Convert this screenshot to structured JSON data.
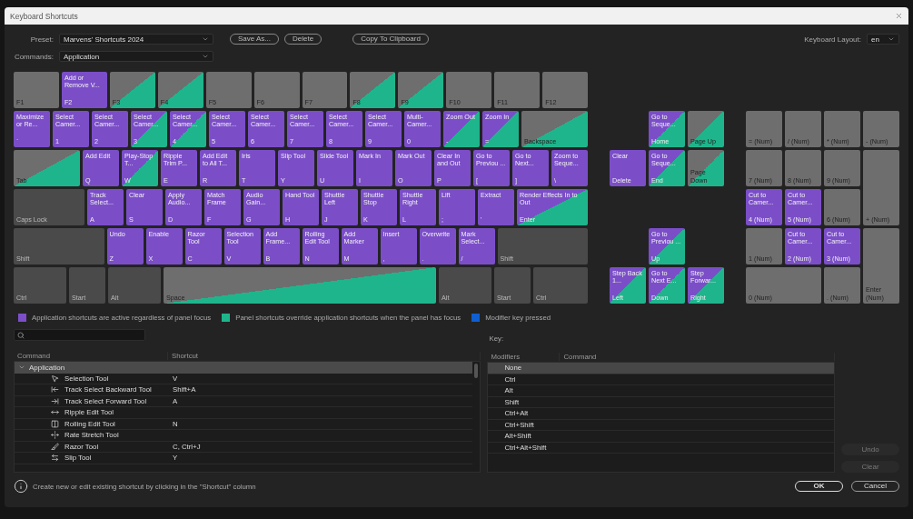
{
  "window": {
    "title": "Keyboard Shortcuts"
  },
  "preset": {
    "label": "Preset:",
    "value": "Marvens' Shortcuts 2024"
  },
  "actions": [
    "Save As...",
    "Delete",
    "Copy To Clipboard"
  ],
  "keyboard_layout": {
    "label": "Keyboard Layout:",
    "value": "en"
  },
  "commands": {
    "label": "Commands:",
    "value": "Application"
  },
  "keyboard": {
    "main_rows": [
      [
        {
          "label": "F1",
          "kind": "empty"
        },
        {
          "label": "F2",
          "kind": "app",
          "command": "Add or Remove V..."
        },
        {
          "label": "F3",
          "kind": "panel"
        },
        {
          "label": "F4",
          "kind": "panel"
        },
        {
          "label": "F5",
          "kind": "empty"
        },
        {
          "label": "F6",
          "kind": "empty"
        },
        {
          "label": "F7",
          "kind": "empty"
        },
        {
          "label": "F8",
          "kind": "panel"
        },
        {
          "label": "F9",
          "kind": "panel"
        },
        {
          "label": "F10",
          "kind": "empty"
        },
        {
          "label": "F11",
          "kind": "empty"
        },
        {
          "label": "F12",
          "kind": "empty"
        }
      ],
      [
        {
          "label": "`",
          "kind": "app",
          "command": "Maximize or Re..."
        },
        {
          "label": "1",
          "kind": "app",
          "command": "Select Camer..."
        },
        {
          "label": "2",
          "kind": "app",
          "command": "Select Camer..."
        },
        {
          "label": "3",
          "kind": "both",
          "command": "Select Camer..."
        },
        {
          "label": "4",
          "kind": "both",
          "command": "Select Camer..."
        },
        {
          "label": "5",
          "kind": "app",
          "command": "Select Camer..."
        },
        {
          "label": "6",
          "kind": "app",
          "command": "Select Camer..."
        },
        {
          "label": "7",
          "kind": "app",
          "command": "Select Camer..."
        },
        {
          "label": "8",
          "kind": "app",
          "command": "Select Camer..."
        },
        {
          "label": "9",
          "kind": "app",
          "command": "Select Camer..."
        },
        {
          "label": "0",
          "kind": "app",
          "command": "Multi-Camer..."
        },
        {
          "label": "-",
          "kind": "both",
          "command": "Zoom Out"
        },
        {
          "label": "=",
          "kind": "both",
          "command": "Zoom In"
        },
        {
          "label": "Backspace",
          "kind": "panel"
        }
      ],
      [
        {
          "label": "Tab",
          "kind": "panel"
        },
        {
          "label": "Q",
          "kind": "app",
          "command": "Add Edit"
        },
        {
          "label": "W",
          "kind": "both",
          "command": "Play-Stop T..."
        },
        {
          "label": "E",
          "kind": "app",
          "command": "Ripple Trim P..."
        },
        {
          "label": "R",
          "kind": "app",
          "command": "Add Edit to All T..."
        },
        {
          "label": "T",
          "kind": "app",
          "command": "Iris"
        },
        {
          "label": "Y",
          "kind": "app",
          "command": "Slip Tool"
        },
        {
          "label": "U",
          "kind": "app",
          "command": "Slide Tool"
        },
        {
          "label": "I",
          "kind": "app",
          "command": "Mark In"
        },
        {
          "label": "O",
          "kind": "app",
          "command": "Mark Out"
        },
        {
          "label": "P",
          "kind": "app",
          "command": "Clear In and Out"
        },
        {
          "label": "[",
          "kind": "app",
          "command": "Go to Previou ..."
        },
        {
          "label": "]",
          "kind": "app",
          "command": "Go to Next..."
        },
        {
          "label": "\\",
          "kind": "app",
          "command": "Zoom to Seque..."
        }
      ],
      [
        {
          "label": "Caps Lock",
          "kind": "modifier"
        },
        {
          "label": "A",
          "kind": "app",
          "command": "Track Select..."
        },
        {
          "label": "S",
          "kind": "app",
          "command": "Clear"
        },
        {
          "label": "D",
          "kind": "app",
          "command": "Apply Audio..."
        },
        {
          "label": "F",
          "kind": "app",
          "command": "Match Frame"
        },
        {
          "label": "G",
          "kind": "app",
          "command": "Audio Gain..."
        },
        {
          "label": "H",
          "kind": "app",
          "command": "Hand Tool"
        },
        {
          "label": "J",
          "kind": "app",
          "command": "Shuttle Left"
        },
        {
          "label": "K",
          "kind": "app",
          "command": "Shuttle Stop"
        },
        {
          "label": "L",
          "kind": "app",
          "command": "Shuttle Right"
        },
        {
          "label": ";",
          "kind": "app",
          "command": "Lift"
        },
        {
          "label": "'",
          "kind": "app",
          "command": "Extract"
        },
        {
          "label": "Enter",
          "kind": "both",
          "command": "Render Effects In to Out"
        }
      ],
      [
        {
          "label": "Shift",
          "kind": "modifier"
        },
        {
          "label": "Z",
          "kind": "app",
          "command": "Undo"
        },
        {
          "label": "X",
          "kind": "app",
          "command": "Enable"
        },
        {
          "label": "C",
          "kind": "app",
          "command": "Razor Tool"
        },
        {
          "label": "V",
          "kind": "app",
          "command": "Selection Tool"
        },
        {
          "label": "B",
          "kind": "app",
          "command": "Add Frame..."
        },
        {
          "label": "N",
          "kind": "app",
          "command": "Rolling Edit Tool"
        },
        {
          "label": "M",
          "kind": "app",
          "command": "Add Marker"
        },
        {
          "label": ",",
          "kind": "app",
          "command": "Insert"
        },
        {
          "label": ".",
          "kind": "app",
          "command": "Overwrite"
        },
        {
          "label": "/",
          "kind": "app",
          "command": "Mark Select..."
        },
        {
          "label": "Shift",
          "kind": "modifier"
        }
      ],
      [
        {
          "label": "Ctrl",
          "kind": "modifier"
        },
        {
          "label": "Start",
          "kind": "modifier"
        },
        {
          "label": "Alt",
          "kind": "modifier"
        },
        {
          "label": "Space",
          "kind": "panel"
        },
        {
          "label": "Alt",
          "kind": "modifier"
        },
        {
          "label": "Start",
          "kind": "modifier"
        },
        {
          "label": "Ctrl",
          "kind": "modifier"
        }
      ]
    ],
    "nav": [
      {
        "label": "Home",
        "kind": "both",
        "command": "Go to Seque..."
      },
      {
        "label": "Page Up",
        "kind": "panel"
      },
      {
        "label": "Delete",
        "kind": "app",
        "command": "Clear"
      },
      {
        "label": "End",
        "kind": "both",
        "command": "Go to Seque..."
      },
      {
        "label": "Page Down",
        "kind": "panel"
      },
      {
        "label": "Up",
        "kind": "both",
        "command": "Go to Previou ..."
      },
      {
        "label": "Left",
        "kind": "both",
        "command": "Step Back 1..."
      },
      {
        "label": "Down",
        "kind": "both",
        "command": "Go to Next E..."
      },
      {
        "label": "Right",
        "kind": "both",
        "command": "Step Forwar..."
      }
    ],
    "numpad": [
      {
        "label": "= (Num)",
        "kind": "empty"
      },
      {
        "label": "/ (Num)",
        "kind": "empty"
      },
      {
        "label": "* (Num)",
        "kind": "empty"
      },
      {
        "label": "- (Num)",
        "kind": "empty"
      },
      {
        "label": "7 (Num)",
        "kind": "empty"
      },
      {
        "label": "8 (Num)",
        "kind": "empty"
      },
      {
        "label": "9 (Num)",
        "kind": "empty"
      },
      {
        "label": "4 (Num)",
        "kind": "app",
        "command": "Cut to Camer..."
      },
      {
        "label": "5 (Num)",
        "kind": "app",
        "command": "Cut to Camer..."
      },
      {
        "label": "6 (Num)",
        "kind": "empty"
      },
      {
        "label": "+ (Num)",
        "kind": "empty"
      },
      {
        "label": "1 (Num)",
        "kind": "empty"
      },
      {
        "label": "2 (Num)",
        "kind": "app",
        "command": "Cut to Camer..."
      },
      {
        "label": "3 (Num)",
        "kind": "app",
        "command": "Cut to Camer..."
      },
      {
        "label": "0 (Num)",
        "kind": "empty"
      },
      {
        "label": ". (Num)",
        "kind": "empty"
      },
      {
        "label": "Enter (Num)",
        "kind": "empty"
      }
    ]
  },
  "legend": [
    {
      "text": "Application shortcuts are active regardless of panel focus",
      "color": "#7c4fc8"
    },
    {
      "text": "Panel shortcuts override application shortcuts when the panel has focus",
      "color": "#1fb58c"
    },
    {
      "text": "Modifier key pressed",
      "color": "#0f5fd0"
    }
  ],
  "command_table": {
    "columns": [
      "Command",
      "Shortcut"
    ],
    "groups": [
      {
        "label": "Application",
        "expanded": true,
        "children": [
          {
            "command": "Selection Tool",
            "shortcut": "V"
          },
          {
            "command": "Track Select Backward Tool",
            "shortcut": "Shift+A"
          },
          {
            "command": "Track Select Forward Tool",
            "shortcut": "A"
          },
          {
            "command": "Ripple Edit Tool"
          },
          {
            "command": "Rolling Edit Tool",
            "shortcut": "N"
          },
          {
            "command": "Rate Stretch Tool"
          },
          {
            "command": "Razor Tool",
            "shortcut": "C, Ctrl+J"
          },
          {
            "command": "Slip Tool",
            "shortcut": "Y"
          }
        ]
      }
    ]
  },
  "key_table": {
    "label": "Key:",
    "columns": [
      "Modifiers",
      "Command"
    ],
    "rows": [
      {
        "modifiers": "None",
        "selected": true
      },
      {
        "modifiers": "Ctrl",
        "selected": false
      },
      {
        "modifiers": "Alt",
        "selected": false
      },
      {
        "modifiers": "Shift",
        "selected": false
      },
      {
        "modifiers": "Ctrl+Alt",
        "selected": false
      },
      {
        "modifiers": "Ctrl+Shift",
        "selected": false
      },
      {
        "modifiers": "Alt+Shift",
        "selected": false
      },
      {
        "modifiers": "Ctrl+Alt+Shift",
        "selected": false
      }
    ]
  },
  "side_buttons": [
    {
      "label": "Undo",
      "disabled": true
    },
    {
      "label": "Clear",
      "disabled": true
    }
  ],
  "hint": "Create new or edit existing shortcut by clicking in the \"Shortcut\" column",
  "footer_buttons": [
    {
      "label": "OK",
      "kind": "primary"
    },
    {
      "label": "Cancel",
      "kind": "secondary"
    }
  ]
}
